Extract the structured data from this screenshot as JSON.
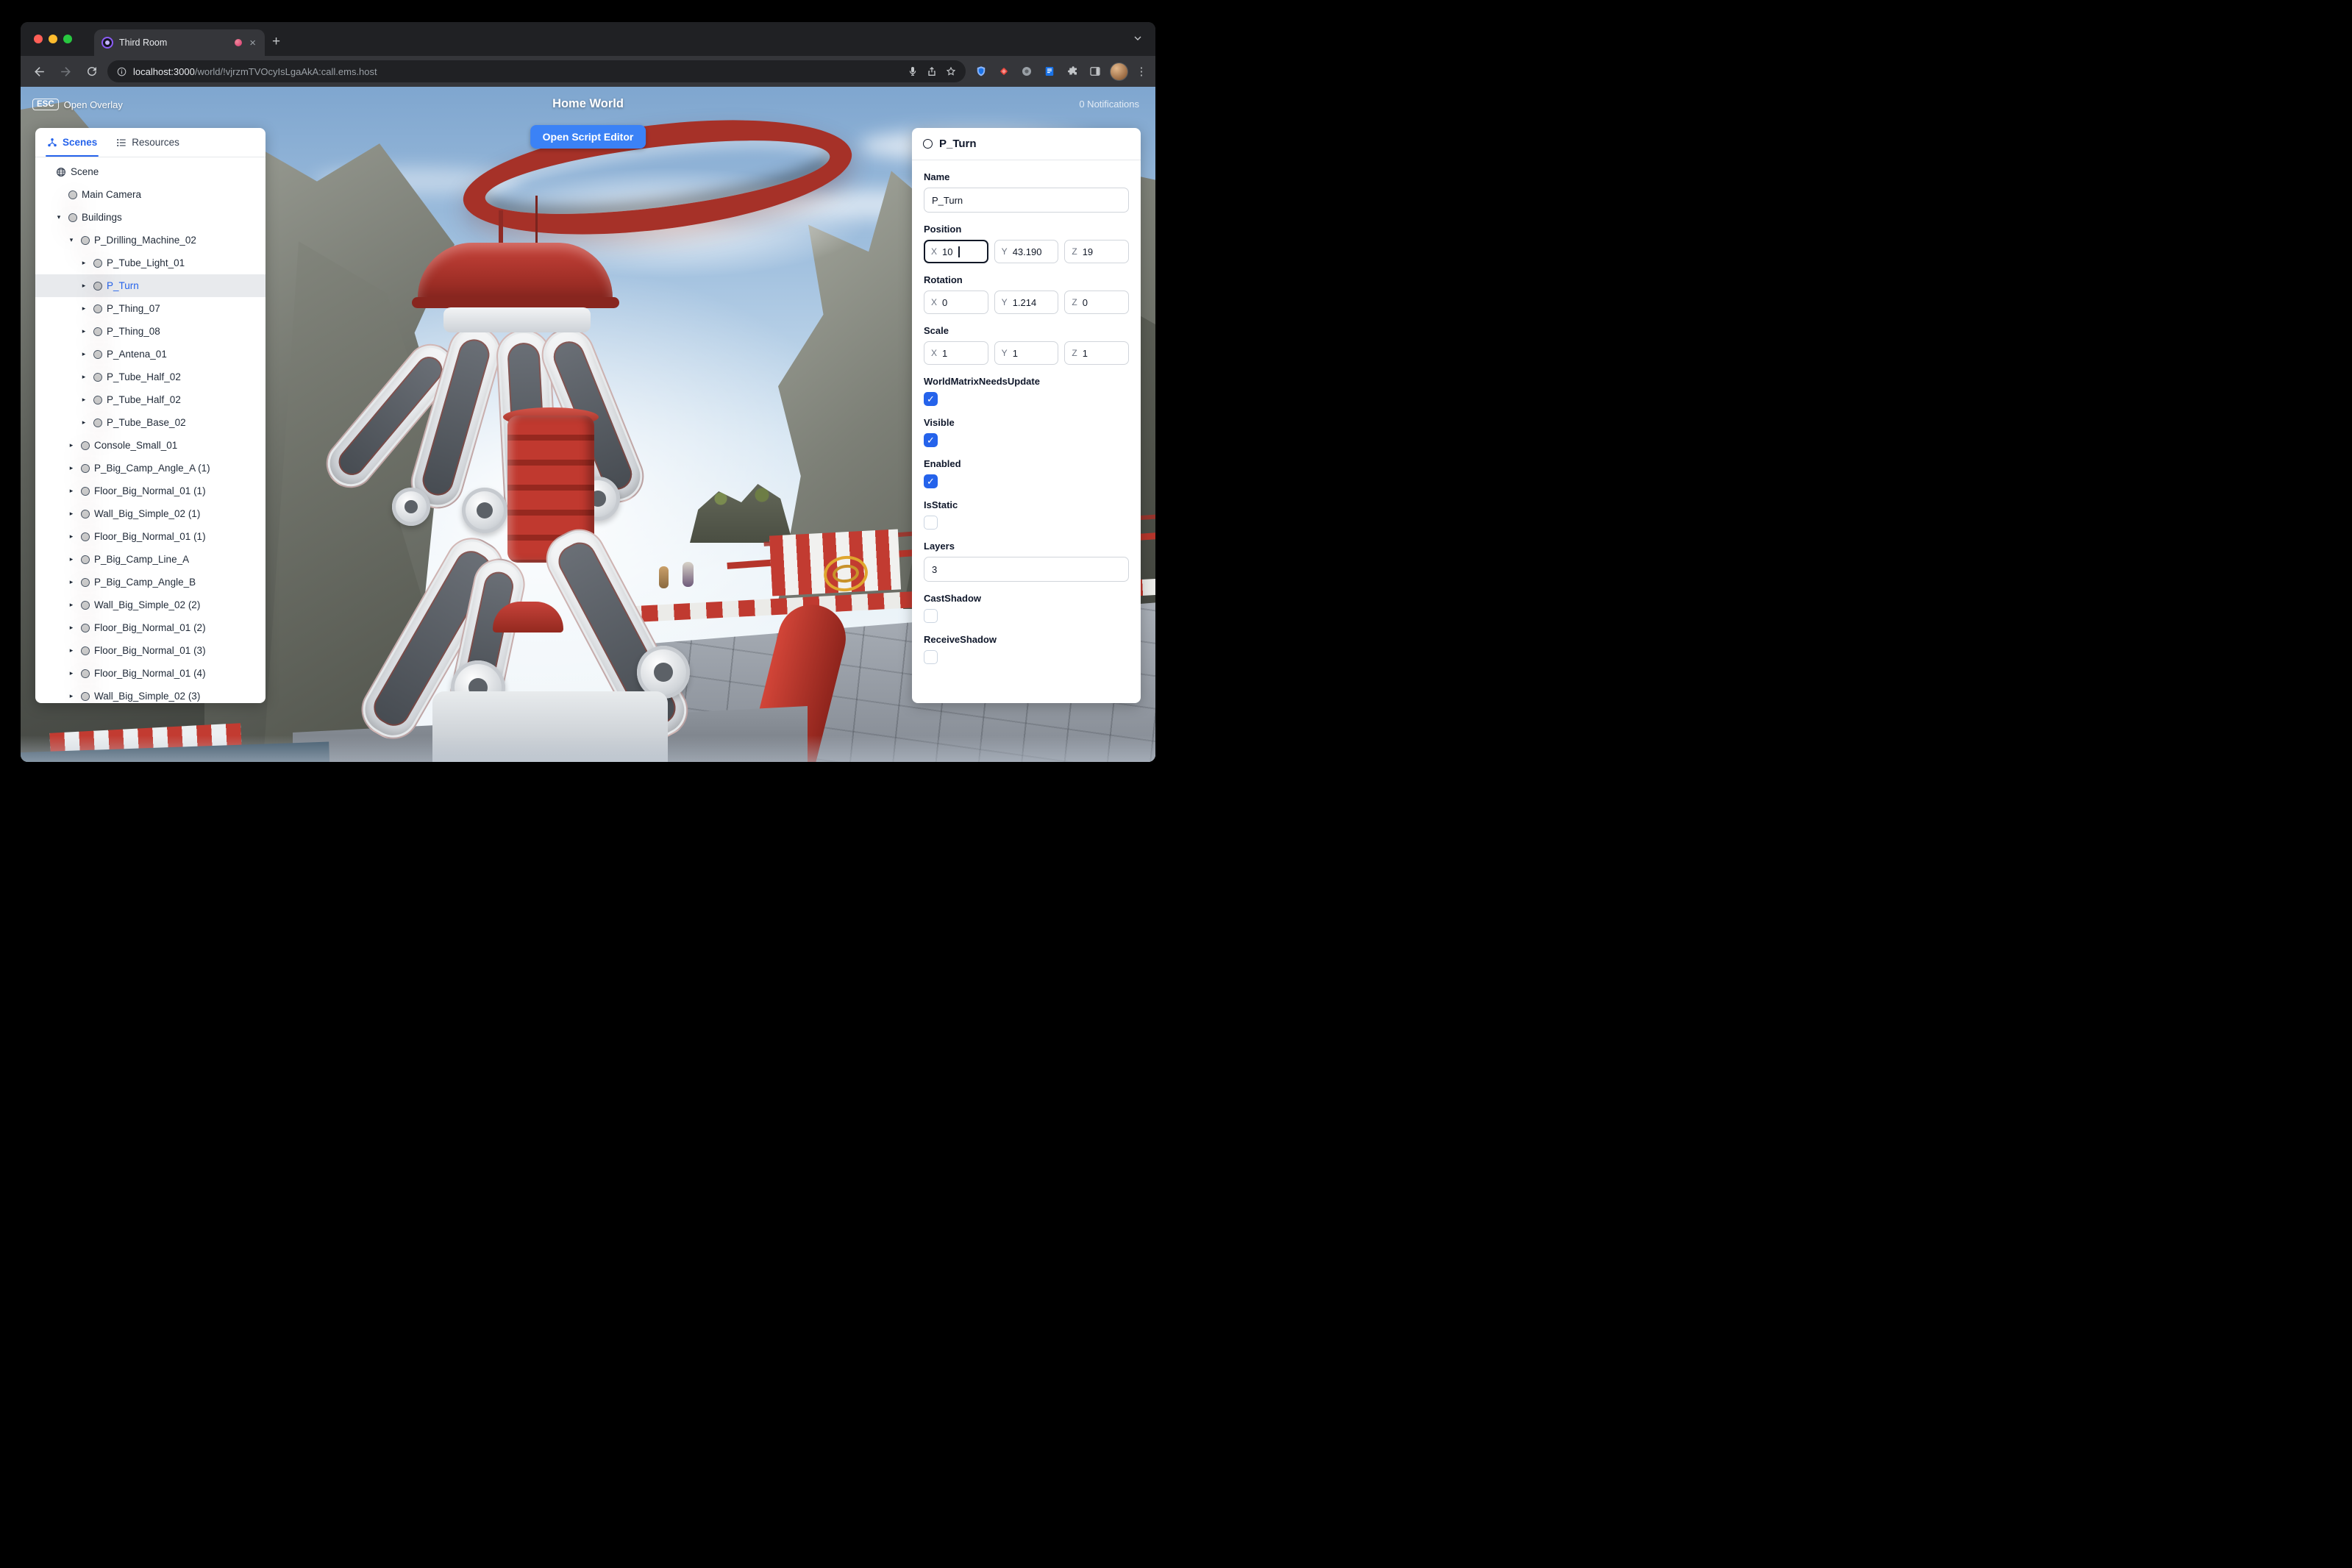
{
  "browser": {
    "tab_title": "Third Room",
    "new_tab_icon": "+",
    "close_tab_icon": "×",
    "menu_icon": "⋮",
    "url_host": "localhost:3000",
    "url_path": "/world/!vjrzmTVOcyIsLgaAkA:call.ems.host"
  },
  "hud": {
    "esc_key": "ESC",
    "esc_label": "Open Overlay",
    "world_title": "Home World",
    "notifications": "0 Notifications",
    "script_editor_button": "Open Script Editor"
  },
  "left_panel": {
    "tabs": [
      {
        "label": "Scenes",
        "active": true
      },
      {
        "label": "Resources",
        "active": false
      }
    ],
    "tree": [
      {
        "label": "Scene",
        "depth": 0,
        "icon": "globe",
        "expander": "none"
      },
      {
        "label": "Main Camera",
        "depth": 1,
        "icon": "node",
        "expander": "none"
      },
      {
        "label": "Buildings",
        "depth": 1,
        "icon": "node",
        "expander": "open"
      },
      {
        "label": "P_Drilling_Machine_02",
        "depth": 2,
        "icon": "node",
        "expander": "open"
      },
      {
        "label": "P_Tube_Light_01",
        "depth": 3,
        "icon": "node",
        "expander": "closed"
      },
      {
        "label": "P_Turn",
        "depth": 3,
        "icon": "node",
        "expander": "closed",
        "selected": true
      },
      {
        "label": "P_Thing_07",
        "depth": 3,
        "icon": "node",
        "expander": "closed"
      },
      {
        "label": "P_Thing_08",
        "depth": 3,
        "icon": "node",
        "expander": "closed"
      },
      {
        "label": "P_Antena_01",
        "depth": 3,
        "icon": "node",
        "expander": "closed"
      },
      {
        "label": "P_Tube_Half_02",
        "depth": 3,
        "icon": "node",
        "expander": "closed"
      },
      {
        "label": "P_Tube_Half_02",
        "depth": 3,
        "icon": "node",
        "expander": "closed"
      },
      {
        "label": "P_Tube_Base_02",
        "depth": 3,
        "icon": "node",
        "expander": "closed"
      },
      {
        "label": "Console_Small_01",
        "depth": 2,
        "icon": "node",
        "expander": "closed"
      },
      {
        "label": "P_Big_Camp_Angle_A (1)",
        "depth": 2,
        "icon": "node",
        "expander": "closed"
      },
      {
        "label": "Floor_Big_Normal_01 (1)",
        "depth": 2,
        "icon": "node",
        "expander": "closed"
      },
      {
        "label": "Wall_Big_Simple_02 (1)",
        "depth": 2,
        "icon": "node",
        "expander": "closed"
      },
      {
        "label": "Floor_Big_Normal_01 (1)",
        "depth": 2,
        "icon": "node",
        "expander": "closed"
      },
      {
        "label": "P_Big_Camp_Line_A",
        "depth": 2,
        "icon": "node",
        "expander": "closed"
      },
      {
        "label": "P_Big_Camp_Angle_B",
        "depth": 2,
        "icon": "node",
        "expander": "closed"
      },
      {
        "label": "Wall_Big_Simple_02 (2)",
        "depth": 2,
        "icon": "node",
        "expander": "closed"
      },
      {
        "label": "Floor_Big_Normal_01 (2)",
        "depth": 2,
        "icon": "node",
        "expander": "closed"
      },
      {
        "label": "Floor_Big_Normal_01 (3)",
        "depth": 2,
        "icon": "node",
        "expander": "closed"
      },
      {
        "label": "Floor_Big_Normal_01 (4)",
        "depth": 2,
        "icon": "node",
        "expander": "closed"
      },
      {
        "label": "Wall_Big_Simple_02 (3)",
        "depth": 2,
        "icon": "node",
        "expander": "closed"
      }
    ]
  },
  "inspector": {
    "title": "P_Turn",
    "name_label": "Name",
    "name_value": "P_Turn",
    "accent_color": "#2563eb",
    "vector_sections": [
      {
        "label": "Position",
        "fields": [
          {
            "axis": "X",
            "value": "10",
            "focused": true
          },
          {
            "axis": "Y",
            "value": "43.190"
          },
          {
            "axis": "Z",
            "value": "19"
          }
        ]
      },
      {
        "label": "Rotation",
        "fields": [
          {
            "axis": "X",
            "value": "0"
          },
          {
            "axis": "Y",
            "value": "1.214"
          },
          {
            "axis": "Z",
            "value": "0"
          }
        ]
      },
      {
        "label": "Scale",
        "fields": [
          {
            "axis": "X",
            "value": "1"
          },
          {
            "axis": "Y",
            "value": "1"
          },
          {
            "axis": "Z",
            "value": "1"
          }
        ]
      }
    ],
    "properties": [
      {
        "label": "WorldMatrixNeedsUpdate",
        "type": "checkbox",
        "checked": true
      },
      {
        "label": "Visible",
        "type": "checkbox",
        "checked": true
      },
      {
        "label": "Enabled",
        "type": "checkbox",
        "checked": true
      },
      {
        "label": "IsStatic",
        "type": "checkbox",
        "checked": false
      },
      {
        "label": "Layers",
        "type": "text",
        "value": "3"
      },
      {
        "label": "CastShadow",
        "type": "checkbox",
        "checked": false
      },
      {
        "label": "ReceiveShadow",
        "type": "checkbox",
        "checked": false
      }
    ]
  }
}
